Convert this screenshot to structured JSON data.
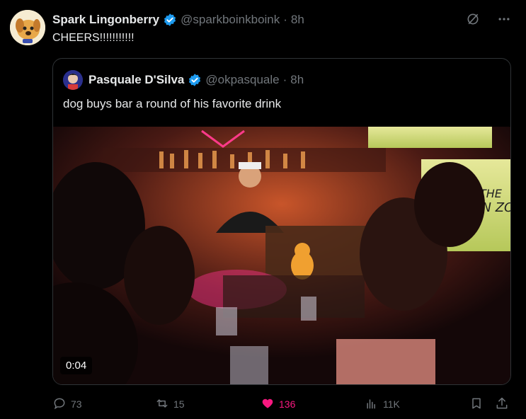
{
  "tweet": {
    "author_name": "Spark Lingonberry",
    "author_handle": "@sparkboinkboink",
    "time": "8h",
    "text": "CHEERS!!!!!!!!!!!"
  },
  "quoted": {
    "author_name": "Pasquale D'Silva",
    "author_handle": "@okpasquale",
    "time": "8h",
    "text": "dog buys bar a round of his favorite drink",
    "video_duration": "0:04"
  },
  "actions": {
    "replies": "73",
    "reposts": "15",
    "likes": "136",
    "views": "11K"
  },
  "colors": {
    "verified": "#1d9bf0",
    "like": "#f91880",
    "muted": "#71767b"
  },
  "separator": "·"
}
